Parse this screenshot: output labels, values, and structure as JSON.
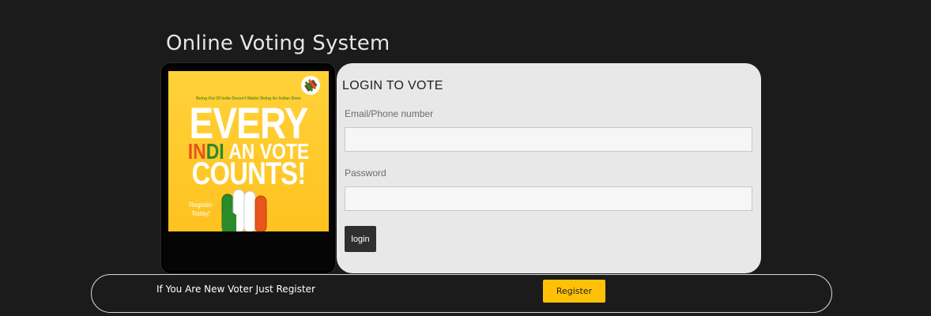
{
  "site": {
    "title": "Online Voting System"
  },
  "poster": {
    "tagline": "Being Out Of India Doesn't Matter Being An Indian Does",
    "line1": "EVERY",
    "line2_in": "IN",
    "line2_di": "DI",
    "line2_rest": "AN VOTE",
    "line3": "COUNTS!",
    "register_line1": "Register",
    "register_line2": "Today!",
    "colors": {
      "background": "#ffc21f",
      "saffron": "#e8541a",
      "green": "#2a8b2a"
    },
    "icons": [
      "raised-fist-tricolor-icon",
      "voting-machine-icon"
    ]
  },
  "login": {
    "heading": "LOGIN TO VOTE",
    "email_label": "Email/Phone number",
    "email_value": "",
    "email_placeholder": "",
    "password_label": "Password",
    "password_value": "",
    "password_placeholder": "",
    "submit_label": "login"
  },
  "register_bar": {
    "text": "If You Are New Voter Just Register",
    "button_label": "Register",
    "button_color": "#ffc107"
  }
}
